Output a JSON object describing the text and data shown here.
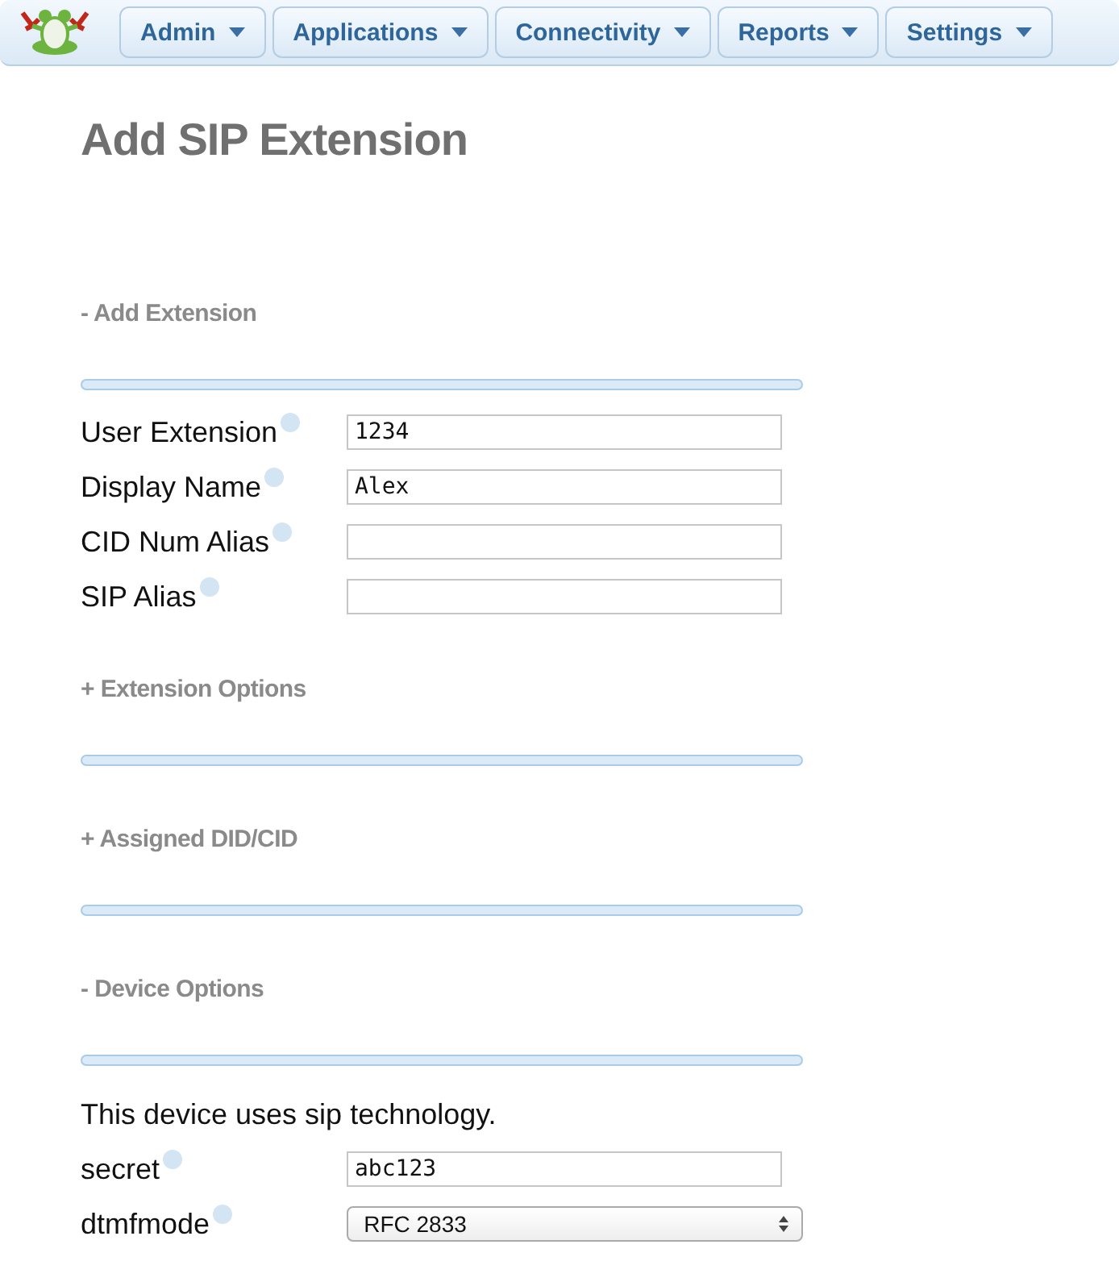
{
  "nav": [
    {
      "label": "Admin"
    },
    {
      "label": "Applications"
    },
    {
      "label": "Connectivity"
    },
    {
      "label": "Reports"
    },
    {
      "label": "Settings"
    }
  ],
  "title": "Add SIP Extension",
  "sections": [
    {
      "heading": "- Add Extension",
      "fields": [
        {
          "label": "User Extension",
          "kind": "text",
          "value": "1234"
        },
        {
          "label": "Display Name",
          "kind": "text",
          "value": "Alex"
        },
        {
          "label": "CID Num Alias",
          "kind": "text"
        },
        {
          "label": "SIP Alias",
          "kind": "text"
        }
      ]
    },
    {
      "heading": "+ Extension Options"
    },
    {
      "heading": "+ Assigned DID/CID"
    },
    {
      "heading": "- Device Options",
      "note": "This device uses sip technology.",
      "fields": [
        {
          "label": "secret",
          "kind": "text",
          "value": "abc123"
        },
        {
          "label": "dtmfmode",
          "kind": "select",
          "value": "RFC 2833"
        }
      ]
    }
  ]
}
